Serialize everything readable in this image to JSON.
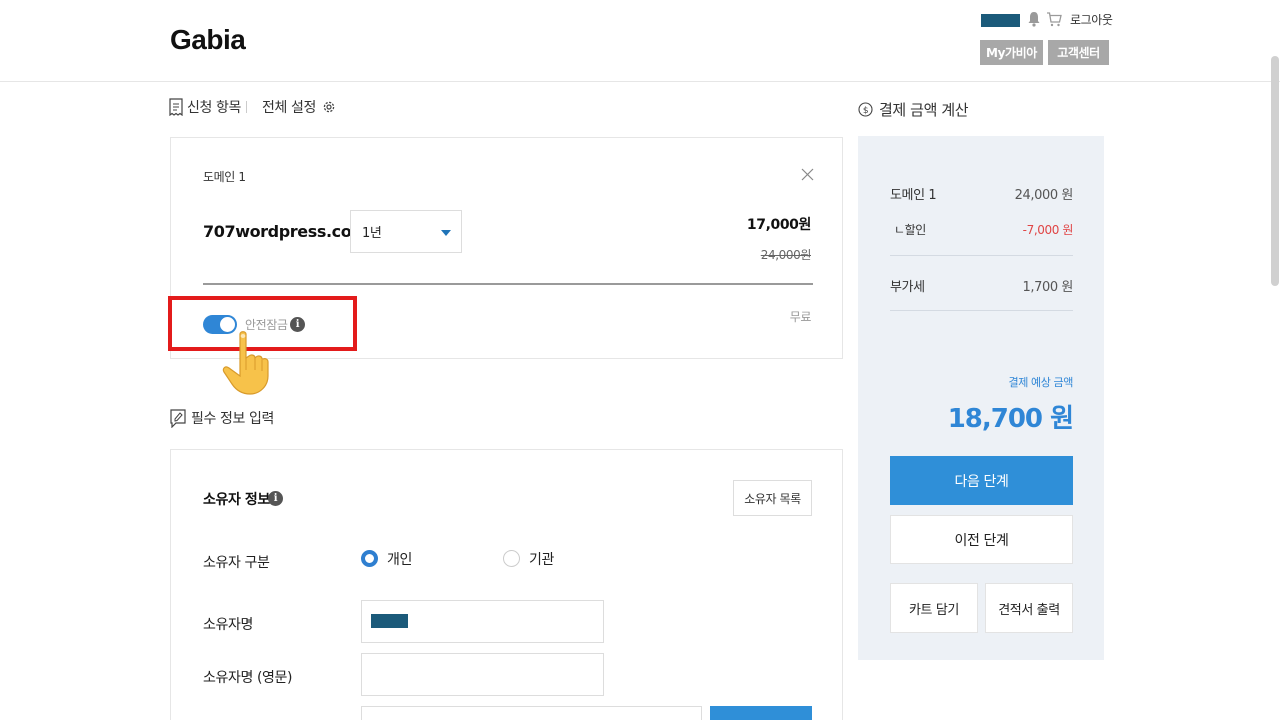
{
  "header": {
    "logo": "Gabia",
    "logout": "로그아웃",
    "my_gabia": "My가비아",
    "customer_center": "고객센터"
  },
  "tabs": {
    "applied_items": "신청 항목",
    "all_settings": "전체 설정"
  },
  "domain": {
    "title": "도메인 1",
    "name": "707wordpress.com",
    "period": "1년",
    "price": "17,000원",
    "original_price": "24,000원",
    "safe_lock_label": "안전잠금",
    "safe_lock_enabled": true,
    "safe_lock_price": "무료"
  },
  "required_info": {
    "section_label": "필수 정보 입력",
    "owner_title": "소유자 정보",
    "owner_list_button": "소유자 목록",
    "owner_type_label": "소유자 구분",
    "owner_type_options": [
      "개인",
      "기관"
    ],
    "owner_type_selected": "개인",
    "owner_name_label": "소유자명",
    "owner_name_en_label": "소유자명 (영문)"
  },
  "payment": {
    "section_label": "결제 금액 계산",
    "domain_label": "도메인 1",
    "domain_price": "24,000 원",
    "discount_label": "ㄴ할인",
    "discount_value": "-7,000 원",
    "vat_label": "부가세",
    "vat_value": "1,700 원",
    "estimated_label": "결제 예상 금액",
    "estimated_amount": "18,700 원",
    "next_button": "다음 단계",
    "prev_button": "이전 단계",
    "cart_button": "카트 담기",
    "quote_button": "견적서 출력"
  },
  "colors": {
    "accent": "#2f8fd8",
    "highlight_box": "#e31b1b",
    "discount": "#e04545"
  }
}
